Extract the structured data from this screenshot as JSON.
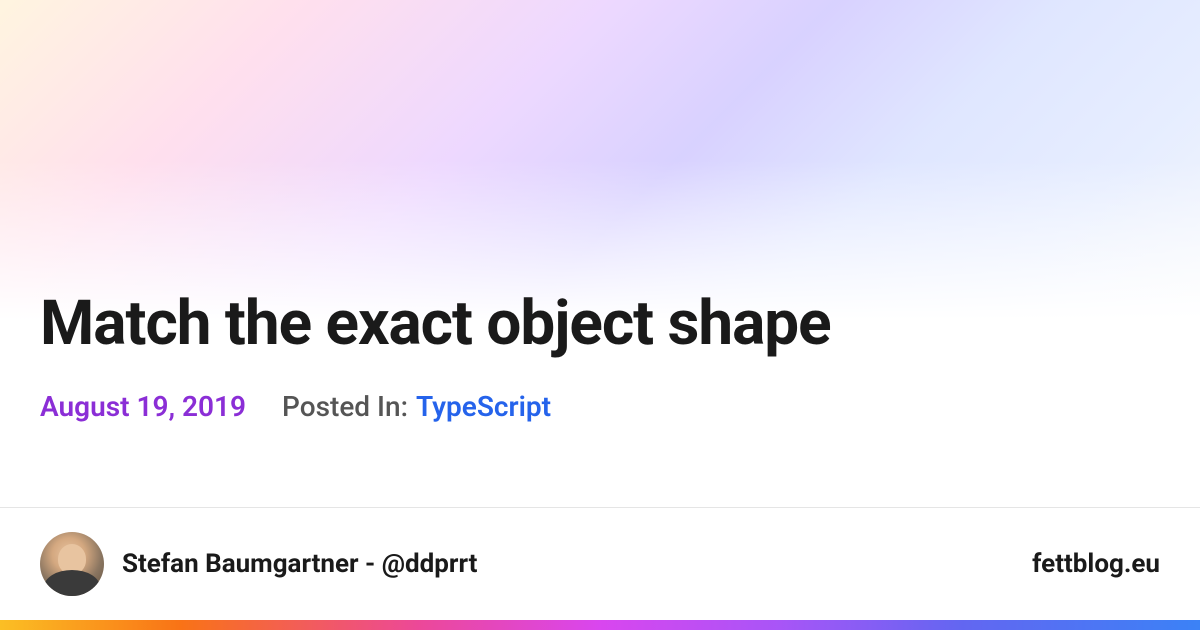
{
  "title": "Match the exact object shape",
  "date": "August 19, 2019",
  "posted_in_label": "Posted In:",
  "category": "TypeScript",
  "author_name": "Stefan Baumgartner - @ddprrt",
  "site_name": "fettblog.eu"
}
